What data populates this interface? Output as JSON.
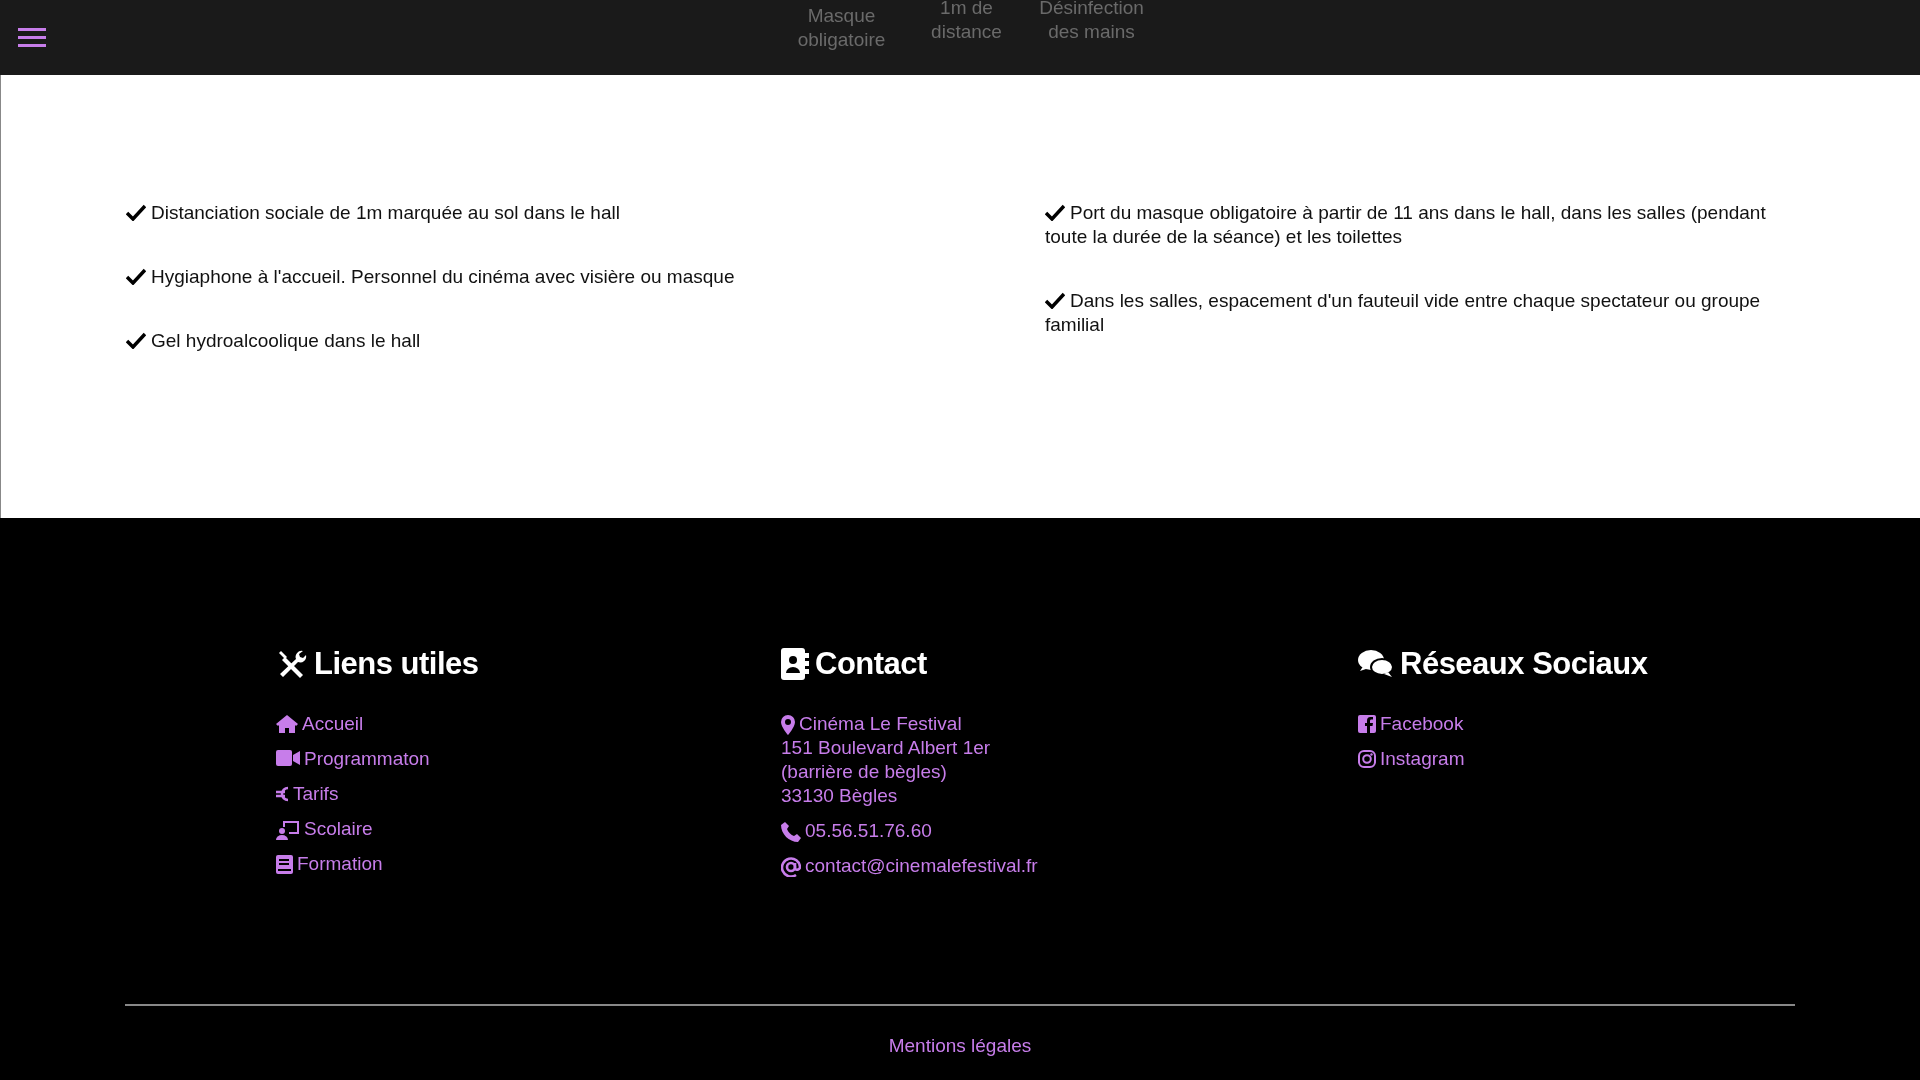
{
  "top_bar": {
    "items": [
      {
        "label": "Masque obligatoire"
      },
      {
        "label": "1m de distance"
      },
      {
        "label": "Désinfection des mains"
      }
    ]
  },
  "measures": {
    "columns": [
      {
        "items": [
          "Distanciation sociale de 1m marquée au sol dans le hall",
          "Hygiaphone à l'accueil. Personnel du cinéma avec visière ou masque",
          "Gel hydroalcoolique dans le hall"
        ]
      },
      {
        "items": [
          "Port du masque obligatoire à partir de 11 ans dans le hall, dans les salles (pendant toute la durée de la séance) et les toilettes",
          "Dans les salles, espacement d'un fauteuil vide entre chaque spectateur ou groupe familial"
        ]
      }
    ]
  },
  "footer": {
    "columns": [
      {
        "title": "Liens utiles",
        "links": [
          {
            "lines": [
              "Accueil"
            ]
          },
          {
            "lines": [
              "Programmaton"
            ]
          },
          {
            "lines": [
              "Tarifs"
            ]
          },
          {
            "lines": [
              "Scolaire"
            ]
          },
          {
            "lines": [
              "Formation"
            ]
          }
        ]
      },
      {
        "title": "Contact",
        "links": [
          {
            "lines": [
              "Cinéma Le Festival",
              "151 Boulevard Albert 1er",
              "(barrière de bègles)",
              "33130 Bègles"
            ]
          },
          {
            "lines": [
              "05.56.51.76.60"
            ]
          },
          {
            "lines": [
              "contact@cinemalefestival.fr"
            ]
          }
        ]
      },
      {
        "title": "Réseaux Sociaux",
        "links": [
          {
            "lines": [
              "Facebook"
            ]
          },
          {
            "lines": [
              "Instagram"
            ]
          }
        ]
      }
    ],
    "legal": "Mentions légales"
  }
}
